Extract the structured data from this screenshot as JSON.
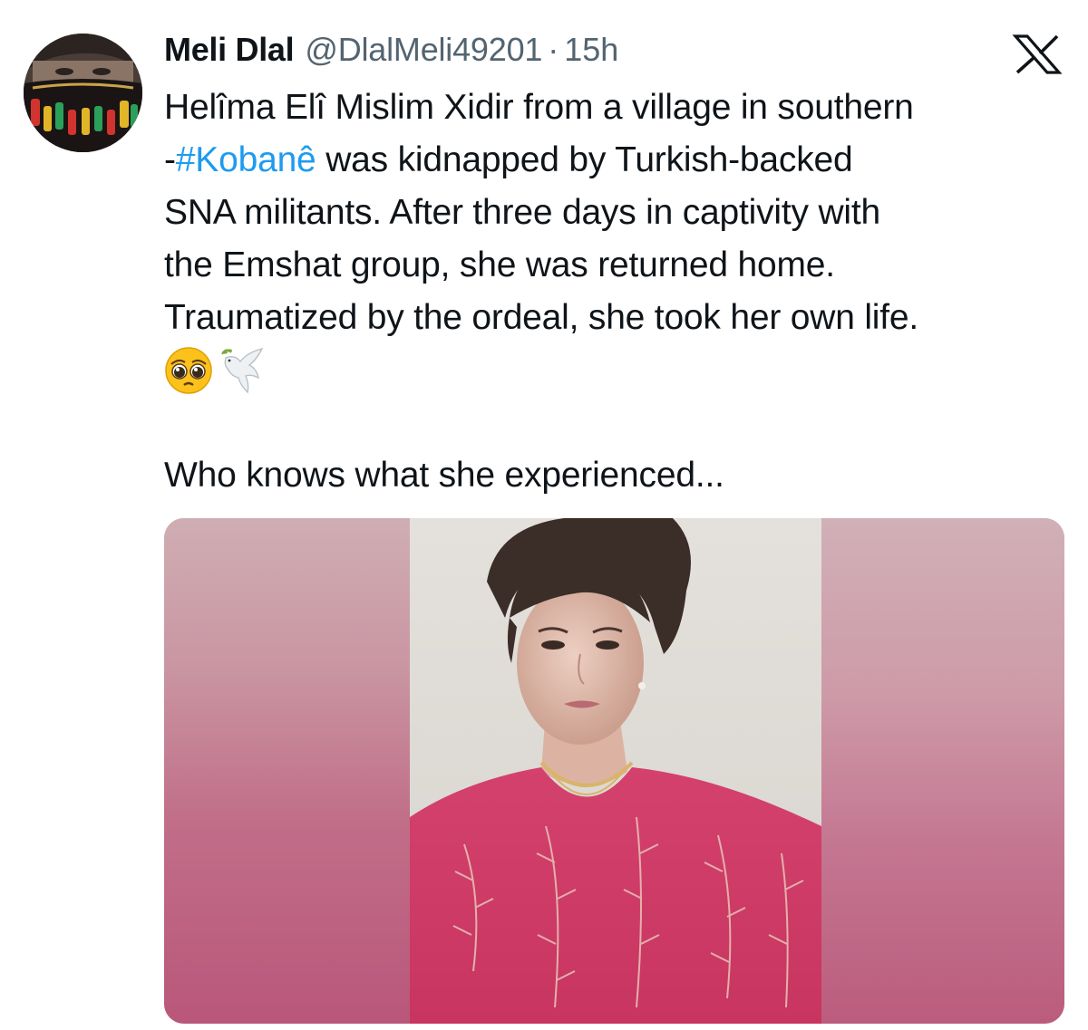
{
  "tweet": {
    "author": {
      "name": "Meli Dlal",
      "handle": "@DlalMeli49201",
      "avatar_icon": "profile-avatar"
    },
    "separator": "·",
    "time": "15h",
    "platform_icon": "x-logo-icon",
    "text": {
      "line1": "Helîma Elî Mislim Xidir from a village in southern",
      "line2_prefix": "-",
      "hashtag": "#Kobanê",
      "line2_rest": " was kidnapped by Turkish-backed",
      "line3": "SNA militants. After three days in captivity with",
      "line4": "the Emshat group, she was returned home.",
      "line5": "Traumatized by the ordeal, she took her own life.",
      "emojis": [
        "pleading-face-emoji",
        "dove-emoji"
      ],
      "line7": "Who knows what she experienced..."
    },
    "media": {
      "type": "photo",
      "description_icon": "tweet-photo"
    },
    "colors": {
      "link": "#1d9bf0",
      "secondary": "#536471",
      "primary": "#0f1419"
    }
  }
}
